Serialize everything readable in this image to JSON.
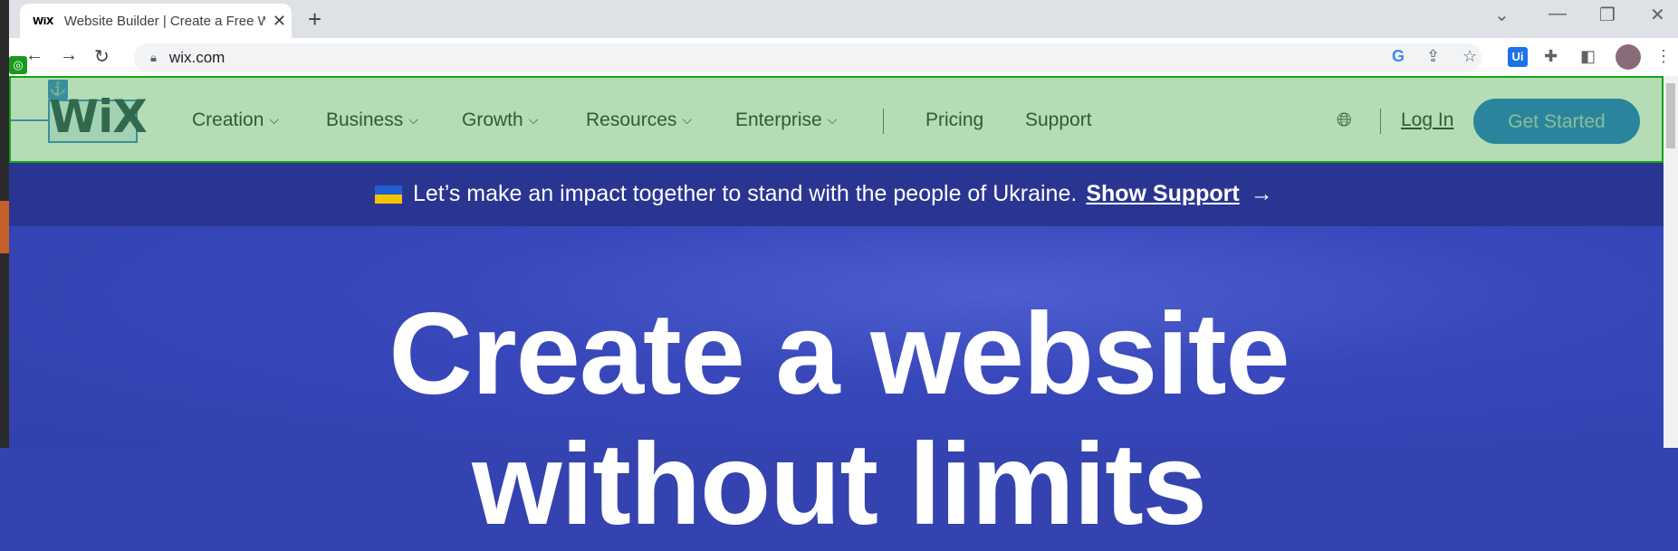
{
  "browser": {
    "tab_favicon": "WiX",
    "tab_title": "Website Builder | Create a Free W",
    "tab_close": "✕",
    "new_tab": "+",
    "url": "wix.com",
    "ext_label": "Ui"
  },
  "site": {
    "logo": "WiX",
    "nav": [
      {
        "label": "Creation"
      },
      {
        "label": "Business"
      },
      {
        "label": "Growth"
      },
      {
        "label": "Resources"
      },
      {
        "label": "Enterprise"
      },
      {
        "label": "Pricing"
      },
      {
        "label": "Support"
      }
    ],
    "login": "Log In",
    "cta": "Get Started"
  },
  "banner": {
    "text": "Let’s make an impact together to stand with the people of Ukraine.",
    "link": "Show Support",
    "arrow": "→"
  },
  "hero": {
    "title_line1": "Create a website",
    "title_line2": "without limits"
  },
  "colors": {
    "cta": "#116dff",
    "banner_bg": "#2a3592",
    "hero_bg": "#3443b0",
    "selection_overlay": "#17a317"
  }
}
